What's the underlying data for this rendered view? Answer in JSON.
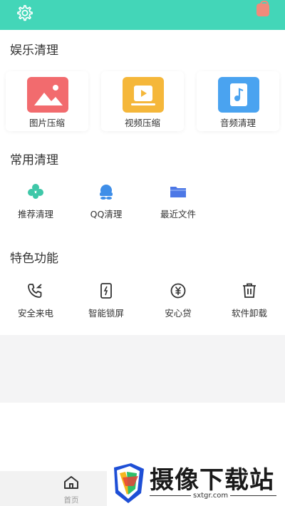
{
  "colors": {
    "accent": "#43d6b8"
  },
  "header": {
    "settings_icon": "gear-icon",
    "right_icon": "bag-icon"
  },
  "sections": {
    "entertainment": {
      "title": "娱乐清理",
      "cards": [
        {
          "label": "图片压缩",
          "icon": "image-icon",
          "color": "#f26b6e"
        },
        {
          "label": "视频压缩",
          "icon": "video-icon",
          "color": "#f5b73a"
        },
        {
          "label": "音频清理",
          "icon": "audio-icon",
          "color": "#4aa3f0"
        }
      ]
    },
    "common": {
      "title": "常用清理",
      "items": [
        {
          "label": "推荐清理",
          "icon": "clover-icon"
        },
        {
          "label": "QQ清理",
          "icon": "qq-icon"
        },
        {
          "label": "最近文件",
          "icon": "folder-icon"
        }
      ]
    },
    "features": {
      "title": "特色功能",
      "items": [
        {
          "label": "安全来电",
          "icon": "phone-icon"
        },
        {
          "label": "智能锁屏",
          "icon": "lock-screen-icon"
        },
        {
          "label": "安心贷",
          "icon": "yuan-icon"
        },
        {
          "label": "软件卸载",
          "icon": "trash-icon"
        }
      ]
    }
  },
  "bottom_nav": {
    "home_label": "首页"
  },
  "watermark": {
    "title": "摄像下载站",
    "url": "sxtgr.com"
  }
}
